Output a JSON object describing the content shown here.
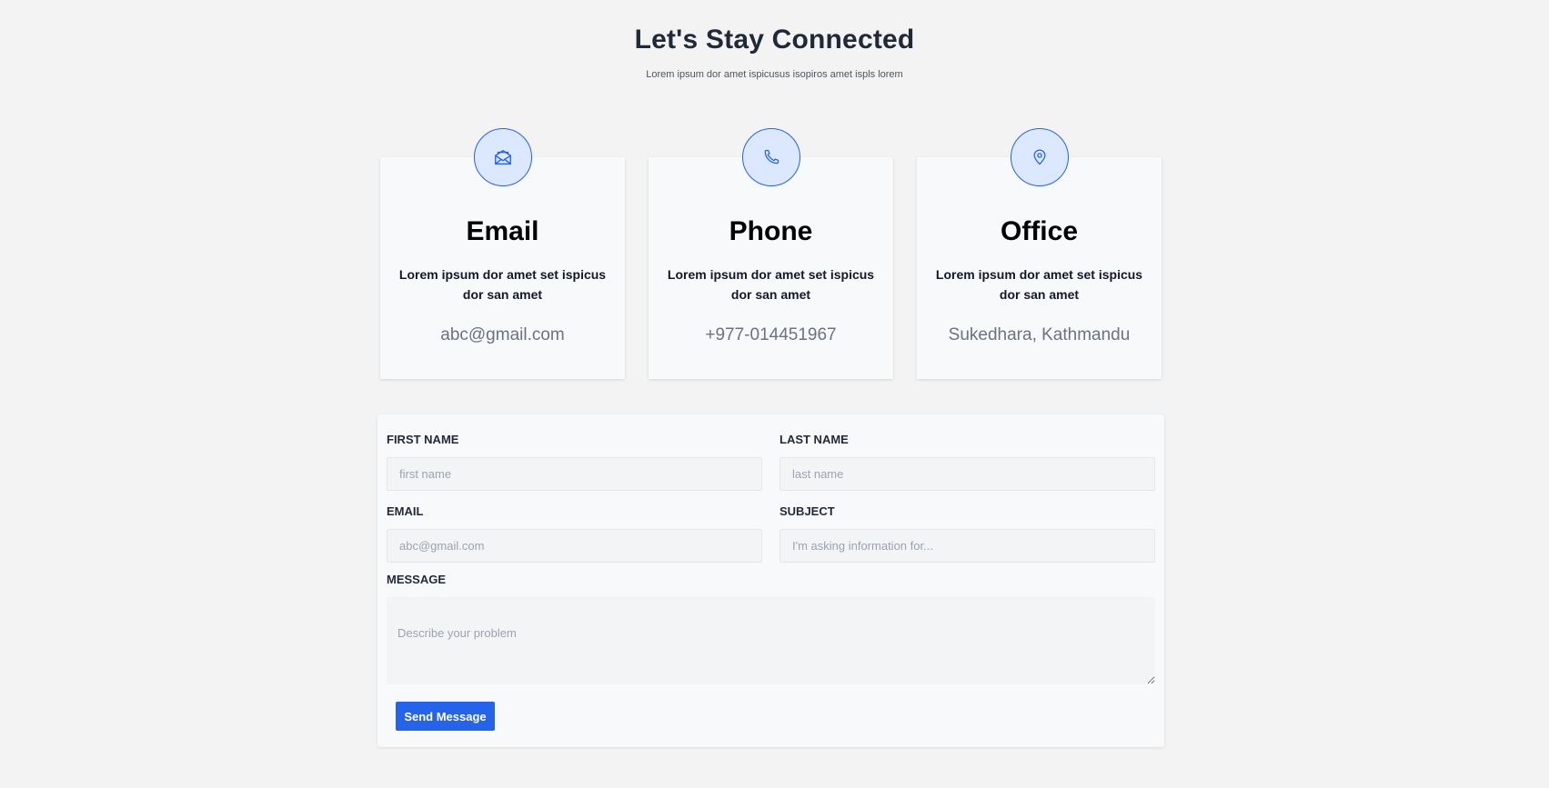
{
  "header": {
    "title": "Let's Stay Connected",
    "subtitle": "Lorem ipsum dor amet ispicusus isopiros amet ispls lorem"
  },
  "cards": [
    {
      "icon": "envelope-open-icon",
      "title": "Email",
      "description": "Lorem ipsum dor amet set ispicus dor san amet",
      "value": "abc@gmail.com"
    },
    {
      "icon": "phone-icon",
      "title": "Phone",
      "description": "Lorem ipsum dor amet set ispicus dor san amet",
      "value": "+977-014451967"
    },
    {
      "icon": "map-pin-icon",
      "title": "Office",
      "description": "Lorem ipsum dor amet set ispicus dor san amet",
      "value": "Sukedhara, Kathmandu"
    }
  ],
  "form": {
    "first_name": {
      "label": "FIRST NAME",
      "placeholder": "first name",
      "value": ""
    },
    "last_name": {
      "label": "LAST NAME",
      "placeholder": "last name",
      "value": ""
    },
    "email": {
      "label": "EMAIL",
      "placeholder": "abc@gmail.com",
      "value": ""
    },
    "subject": {
      "label": "SUBJECT",
      "placeholder": "I'm asking information for...",
      "value": ""
    },
    "message": {
      "label": "MESSAGE",
      "placeholder": "Describe your problem",
      "value": ""
    },
    "submit_label": "Send Message"
  },
  "colors": {
    "accent": "#2563eb",
    "icon_bg": "#dbe8fd",
    "page_bg": "#f3f3f3",
    "card_bg": "#f8f9fb"
  }
}
